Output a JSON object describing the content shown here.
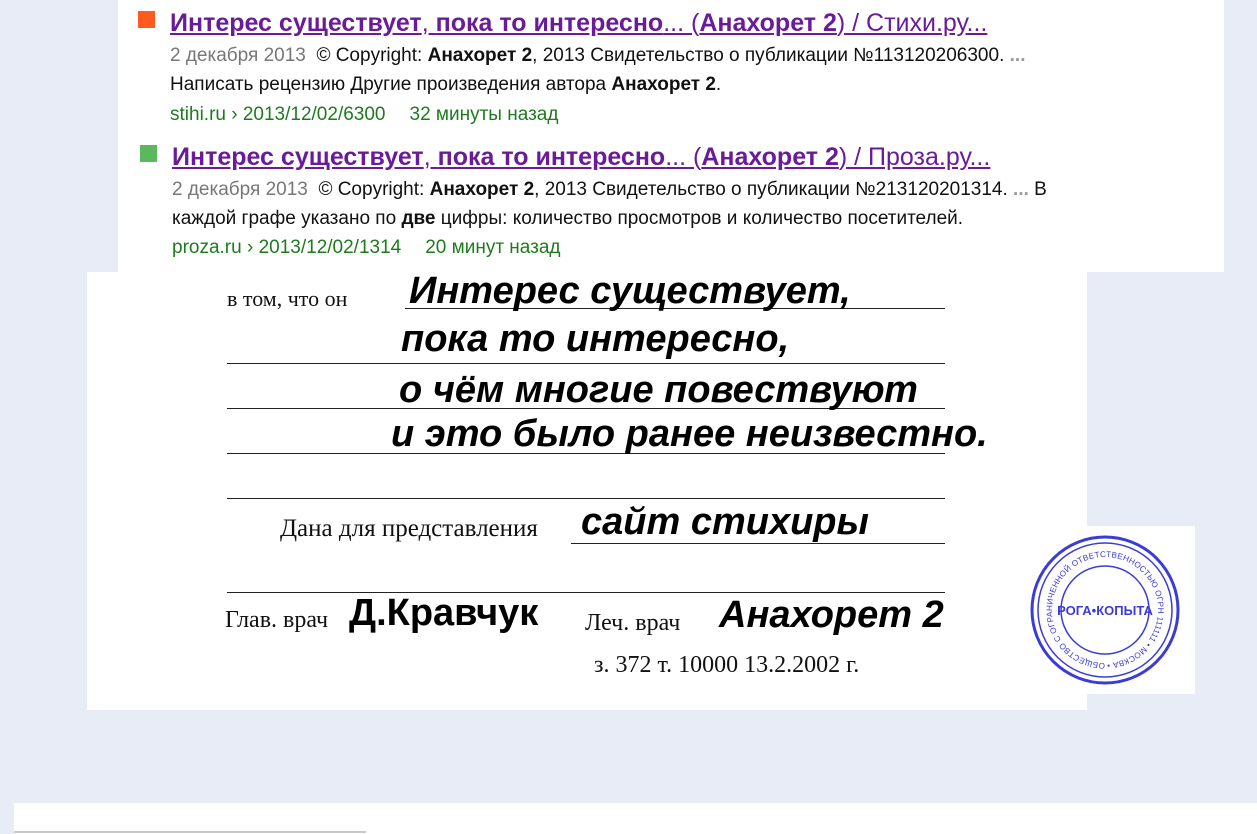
{
  "results": [
    {
      "marker_color": "#ff5a1f",
      "title": {
        "p1": "Интерес существует",
        "p2": ", ",
        "p3": "пока то интересно",
        "p4": "... (",
        "p5": "Анахорет 2",
        "p6": ") / Стихи.ру..."
      },
      "date": "2 декабря 2013",
      "snippet1": {
        "a": "© Copyright: ",
        "b": "Анахорет 2",
        "c": ", 2013 Свидетельство о публикации №113120206300. ",
        "ell": "..."
      },
      "snippet2": {
        "a": "Написать рецензию Другие произведения автора ",
        "b": "Анахорет 2",
        "c": "."
      },
      "url": "stihi.ru › 2013/12/02/6300",
      "ago": "32 минуты назад"
    },
    {
      "marker_color": "#5cb85c",
      "title": {
        "p1": "Интерес существует",
        "p2": ", ",
        "p3": "пока то интересно",
        "p4": "... (",
        "p5": "Анахорет 2",
        "p6": ") / Проза.ру..."
      },
      "date": "2 декабря 2013",
      "snippet1": {
        "a": "© Copyright: ",
        "b": "Анахорет 2",
        "c": ", 2013 Свидетельство о публикации №213120201314. ",
        "ell": "...",
        "d": " В"
      },
      "snippet2": {
        "a": "каждой графе указано по ",
        "b": "две",
        "c": " цифры: количество просмотров и количество посетителей."
      },
      "url": "proza.ru › 2013/12/02/1314",
      "ago": "20 минут назад"
    }
  ],
  "document": {
    "label_v_tom": "в том, что он",
    "hand_line1": "Интерес существует,",
    "hand_line2": "пока то интересно,",
    "hand_line3": "о чём многие повествуют",
    "hand_line4": "и это было ранее  неизвестно.",
    "label_dana": "Дана для представления",
    "hand_site": "сайт стихиры",
    "label_glav": "Глав. врач",
    "hand_glav": "Д.Кравчук",
    "label_lech": "Леч. врач",
    "hand_lech": "Анахорет 2",
    "footnote": "з. 372 т. 10000  13.2.2002 г."
  },
  "stamp": {
    "center_text": "РОГА•КОПЫТА",
    "ring_text": "ОБЩЕСТВО С ОГРАНИЧЕННОЙ ОТВЕТСТВЕННОСТЬЮ ОГРН 111111 • МОСКВА •",
    "color": "#3b3bd6"
  }
}
